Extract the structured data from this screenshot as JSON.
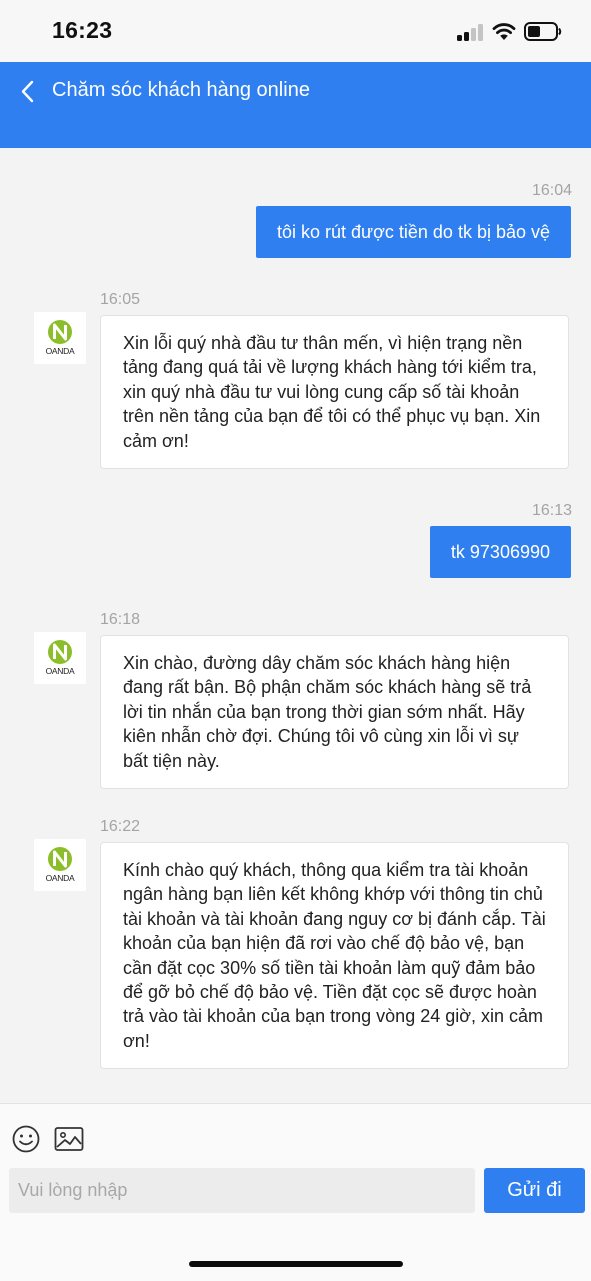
{
  "status_bar": {
    "time": "16:23"
  },
  "header": {
    "title": "Chăm sóc khách hàng online"
  },
  "messages": [
    {
      "direction": "out",
      "time": "16:04",
      "text": "tôi ko rút được tiền do tk bị bảo vệ"
    },
    {
      "direction": "in",
      "time": "16:05",
      "text": "Xin lỗi quý nhà đầu tư thân mến, vì hiện trạng nền tảng đang quá tải về lượng khách hàng tới kiểm tra, xin quý nhà đầu tư vui lòng cung cấp số tài khoản trên nền tảng của bạn để tôi có thể phục vụ bạn. Xin cảm ơn!"
    },
    {
      "direction": "out",
      "time": "16:13",
      "text": "tk 97306990"
    },
    {
      "direction": "in",
      "time": "16:18",
      "text": "Xin chào, đường dây chăm sóc khách hàng hiện đang rất bận. Bộ phận chăm sóc khách hàng sẽ trả lời tin nhắn của bạn trong thời gian sớm nhất. Hãy kiên nhẫn chờ đợi. Chúng tôi vô cùng xin lỗi vì sự bất tiện này."
    },
    {
      "direction": "in",
      "time": "16:22",
      "text": "Kính chào quý khách, thông qua kiểm tra tài khoản ngân hàng bạn liên kết không khớp với thông tin chủ tài khoản và tài khoản đang nguy cơ bị đánh cắp. Tài khoản của bạn hiện đã rơi vào chế độ bảo vệ, bạn cần đặt cọc 30% số tiền tài khoản làm quỹ đảm bảo để gỡ bỏ chế độ bảo vệ. Tiền đặt cọc sẽ được hoàn trả vào tài khoản của bạn trong vòng 24 giờ, xin cảm ơn!"
    }
  ],
  "agent": {
    "avatar_text": "OANDA"
  },
  "composer": {
    "placeholder": "Vui lòng nhập",
    "value": "",
    "send_label": "Gửi đi",
    "emoji_icon": "smiley-face-icon",
    "image_icon": "image-icon"
  },
  "colors": {
    "accent": "#2f7ff0",
    "background": "#f3f3f3",
    "logo_green": "#8cbe2a"
  }
}
